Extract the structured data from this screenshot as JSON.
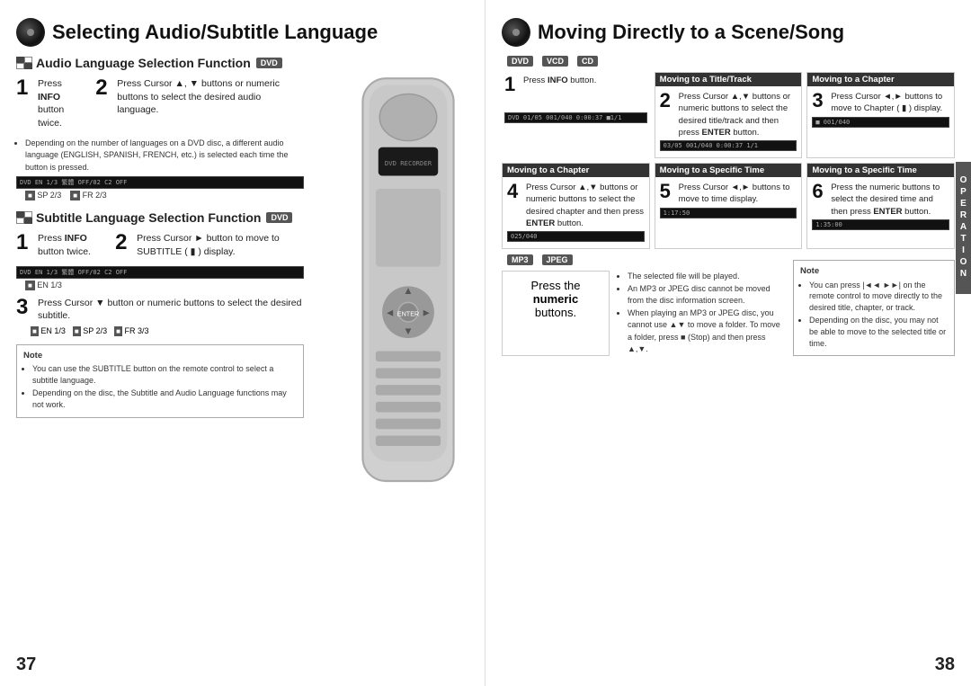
{
  "left_page": {
    "page_num": "37",
    "title": "Selecting Audio/Subtitle Language",
    "section1": {
      "title": "Audio Language Selection Function",
      "badge": "DVD",
      "step1": {
        "num": "1",
        "text": "Press INFO button twice."
      },
      "step2": {
        "num": "2",
        "text": "Press Cursor ▲, ▼ buttons or numeric buttons to select the desired audio language."
      },
      "note_bullet": "Depending on the number of languages on a DVD disc, a different audio language (ENGLISH, SPANISH, FRENCH, etc.) is selected each time the button is pressed.",
      "display1": "DVD  EN 1/3  繁體  OFF/02  C2 OFF",
      "display2": "SP 2/3",
      "display3": "FR 2/3"
    },
    "section2": {
      "title": "Subtitle Language Selection Function",
      "badge": "DVD",
      "step1": {
        "num": "1",
        "text": "Press INFO button twice."
      },
      "step2": {
        "num": "2",
        "text": "Press Cursor ► button to move to SUBTITLE (  ) display."
      },
      "step3": {
        "num": "3",
        "text": "Press Cursor ▼ button or numeric buttons to select the desired subtitle."
      },
      "display_sub1": "DVD  EN 1/3  繁體  OFF/02  C2 OFF",
      "display_sub2": "EN 1/3",
      "display_sub3": "SP 2/3",
      "display_sub4": "FR 3/3"
    },
    "note": {
      "title": "Note",
      "bullets": [
        "You can use the SUBTITLE button on the remote control to select a subtitle language.",
        "Depending on the disc, the Subtitle and Audio Language functions may not work."
      ]
    }
  },
  "right_page": {
    "page_num": "38",
    "title": "Moving Directly to a Scene/Song",
    "operation_label": "OPERATION",
    "format_badges": [
      "DVD",
      "VCD",
      "CD"
    ],
    "step1": {
      "num": "1",
      "text": "Press INFO button."
    },
    "panel_title_track": "Moving to a Title/Track",
    "panel_title_chapter_right": "Moving to a Chapter",
    "step2": {
      "num": "2",
      "text": "Press Cursor ▲,▼ buttons or numeric buttons to select the desired title/track and then press ENTER button."
    },
    "step3": {
      "num": "3",
      "text": "Press Cursor ◄,► buttons to move to Chapter (  ) display."
    },
    "display_r1": "03/05    001/040    0:00:37    1/1",
    "display_r2": "001/040",
    "panel_chapter": "Moving to a Chapter",
    "panel_specific1": "Moving to a Specific Time",
    "panel_specific2": "Moving to a Specific Time",
    "step4": {
      "num": "4",
      "text": "Press Cursor ▲,▼ buttons or numeric buttons to select the desired chapter and then press ENTER button."
    },
    "step5": {
      "num": "5",
      "text": "Press Cursor ◄,► buttons to move to time display."
    },
    "step6": {
      "num": "6",
      "text": "Press the numeric buttons to select the desired time and then press ENTER button."
    },
    "display_ch": "025/040",
    "display_time1": "1:17:50",
    "display_time2": "1:35:00",
    "mp3_jpeg_badges": [
      "MP3",
      "JPEG"
    ],
    "press_numeric": "Press the",
    "press_numeric_bold": "numeric",
    "press_numeric_end": "buttons.",
    "mp3_bullets": [
      "The selected file will be played.",
      "An MP3 or JPEG disc cannot be moved from the disc information screen.",
      "When playing an MP3 or JPEG disc, you cannot use ▲▼ to move a folder. To move a folder, press ■ (Stop) and then press ▲,▼."
    ],
    "note2": {
      "title": "Note",
      "bullets": [
        "You can press |◄◄ ►►| on the remote control to move directly to the desired title, chapter, or track.",
        "Depending on the disc, you may not be able to move to the selected title or time."
      ]
    }
  }
}
